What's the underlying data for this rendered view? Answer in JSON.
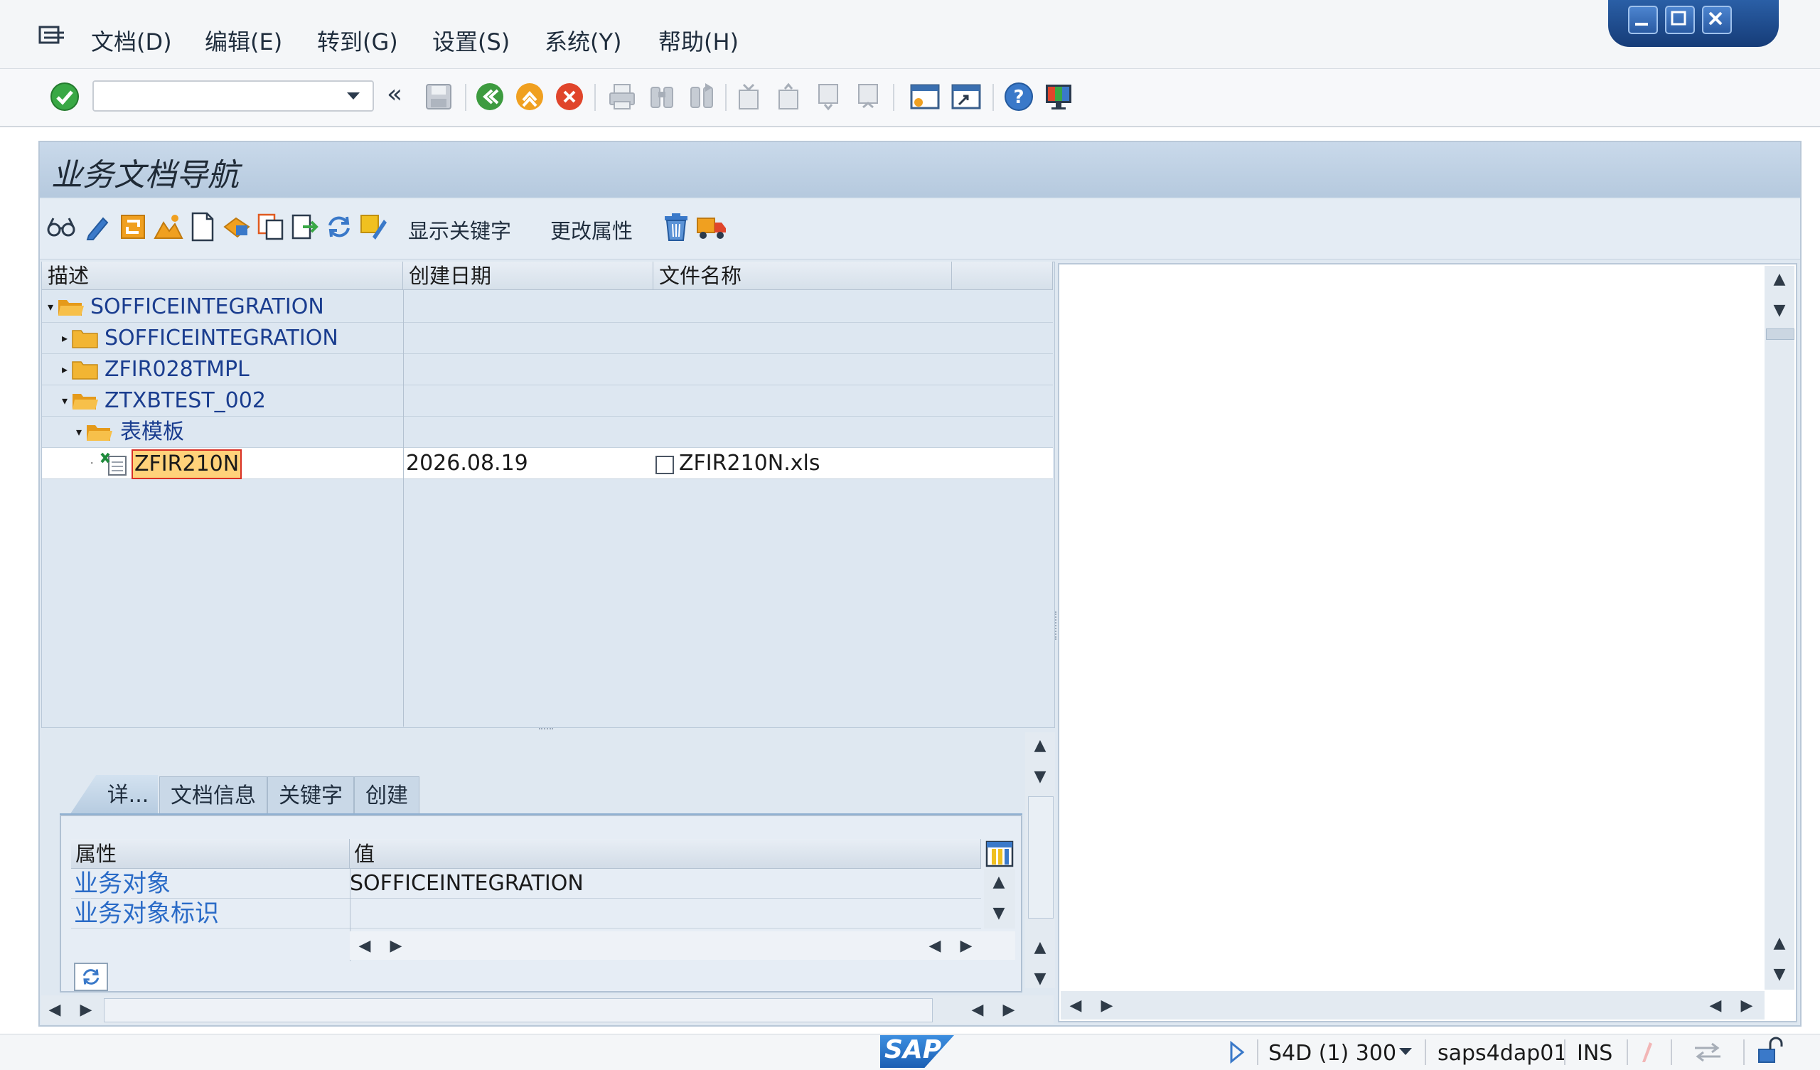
{
  "menu": {
    "items": [
      "文档(D)",
      "编辑(E)",
      "转到(G)",
      "设置(S)",
      "系统(Y)",
      "帮助(H)"
    ]
  },
  "toolbar": {
    "command_value": "",
    "nav_back_symbol": "«",
    "icons": [
      "check-icon",
      "save-icon",
      "back-icon",
      "exit-icon",
      "cancel-icon",
      "print-icon",
      "find-icon",
      "find-next-icon",
      "first-page-icon",
      "prev-page-icon",
      "next-page-icon",
      "last-page-icon",
      "new-session-icon",
      "shortcut-icon",
      "help-icon",
      "customize-layout-icon"
    ]
  },
  "page": {
    "title": "业务文档导航"
  },
  "app_toolbar": {
    "show_keywords": "显示关键字",
    "change_attributes": "更改属性"
  },
  "tree": {
    "columns": [
      "描述",
      "创建日期",
      "文件名称"
    ],
    "rows": [
      {
        "label": "SOFFICEINTEGRATION",
        "level": 0,
        "type": "folder-open",
        "date": "",
        "file": ""
      },
      {
        "label": "SOFFICEINTEGRATION",
        "level": 1,
        "type": "folder",
        "date": "",
        "file": ""
      },
      {
        "label": "ZFIR028TMPL",
        "level": 1,
        "type": "folder",
        "date": "",
        "file": ""
      },
      {
        "label": "ZTXBTEST_002",
        "level": 1,
        "type": "folder-open",
        "date": "",
        "file": ""
      },
      {
        "label": "表模板",
        "level": 2,
        "type": "folder-open",
        "date": "",
        "file": ""
      },
      {
        "label": "ZFIR210N",
        "level": 3,
        "type": "excel-doc",
        "date": "2026.08.19",
        "file": "ZFIR210N.xls",
        "selected": true
      }
    ]
  },
  "details": {
    "tabs": [
      "详...",
      "文档信息",
      "关键字",
      "创建"
    ],
    "active_tab": 0,
    "columns": [
      "属性",
      "值"
    ],
    "rows": [
      {
        "key": "业务对象",
        "value": "SOFFICEINTEGRATION"
      },
      {
        "key": "业务对象标识",
        "value": ""
      }
    ]
  },
  "status": {
    "logo": "SAP",
    "system": "S4D (1) 300",
    "server": "saps4dap01",
    "mode": "INS"
  },
  "colors": {
    "accent": "#2a6bc7",
    "title_bg": "#b5c9de",
    "tree_bg": "#dde7f1",
    "selection": "#ffd27a",
    "folder": "#f2b533"
  }
}
